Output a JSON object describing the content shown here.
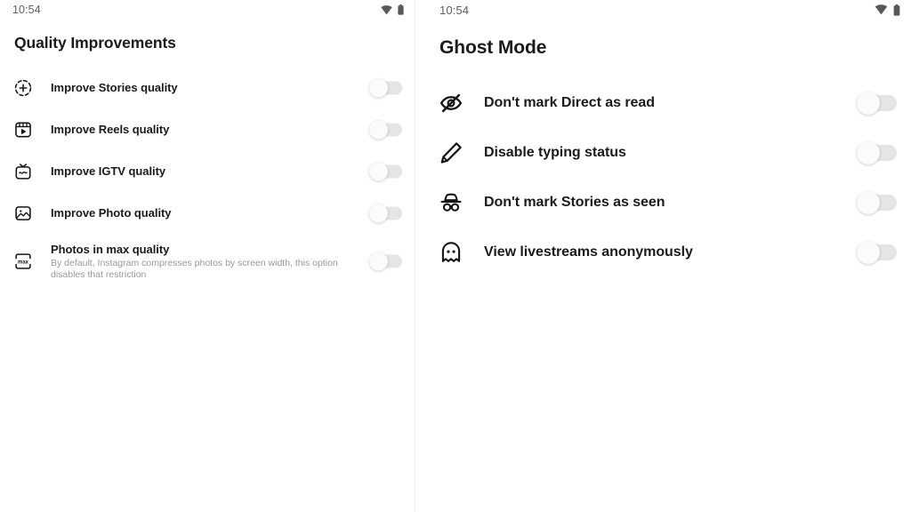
{
  "left_panel": {
    "status_bar": {
      "time": "10:54",
      "wifi_icon": "wifi-icon",
      "battery_icon": "battery-icon"
    },
    "title": "Quality Improvements",
    "items": [
      {
        "icon": "add-to-story-icon",
        "label": "Improve Stories quality",
        "subtitle": "",
        "toggle": "off"
      },
      {
        "icon": "reels-icon",
        "label": "Improve Reels quality",
        "subtitle": "",
        "toggle": "off"
      },
      {
        "icon": "igtv-icon",
        "label": "Improve IGTV quality",
        "subtitle": "",
        "toggle": "off"
      },
      {
        "icon": "photo-icon",
        "label": "Improve Photo quality",
        "subtitle": "",
        "toggle": "off"
      },
      {
        "icon": "max-quality-icon",
        "label": "Photos in max quality",
        "subtitle": "By default, Instagram compresses photos by screen width, this option disables that restriction",
        "toggle": "off"
      }
    ]
  },
  "right_panel": {
    "status_bar": {
      "time": "10:54",
      "wifi_icon": "wifi-icon",
      "battery_icon": "battery-icon"
    },
    "title": "Ghost Mode",
    "items": [
      {
        "icon": "eye-off-icon",
        "label": "Don't mark Direct as read",
        "toggle": "off"
      },
      {
        "icon": "pencil-icon",
        "label": "Disable typing status",
        "toggle": "off"
      },
      {
        "icon": "incognito-icon",
        "label": "Don't mark Stories as seen",
        "toggle": "off"
      },
      {
        "icon": "ghost-icon",
        "label": "View livestreams anonymously",
        "toggle": "off"
      }
    ]
  },
  "colors": {
    "background": "#ffffff",
    "text_primary": "#1b1b1b",
    "text_secondary": "#9a9a9a",
    "status_text": "#5f5f5f",
    "toggle_track_off": "#cfcfcf",
    "toggle_thumb": "#fbfbfb"
  }
}
